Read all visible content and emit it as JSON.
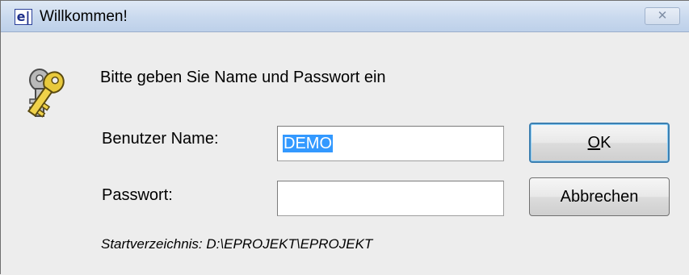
{
  "window": {
    "title": "Willkommen!",
    "app_icon_glyph": "e|",
    "close_glyph": "✕"
  },
  "dialog": {
    "prompt": "Bitte geben Sie Name und Passwort ein",
    "icon": "keys-icon",
    "username_label": "Benutzer Name:",
    "username_value": "DEMO",
    "password_label": "Passwort:",
    "password_value": "",
    "ok_label_mnemonic": "O",
    "ok_label_rest": "K",
    "cancel_label": "Abbrechen",
    "start_directory": "Startverzeichnis: D:\\EPROJEKT\\EPROJEKT"
  },
  "colors": {
    "selection": "#3399ff",
    "titlebar": "#c9d9ee",
    "default_button_border": "#3c7fb1"
  }
}
